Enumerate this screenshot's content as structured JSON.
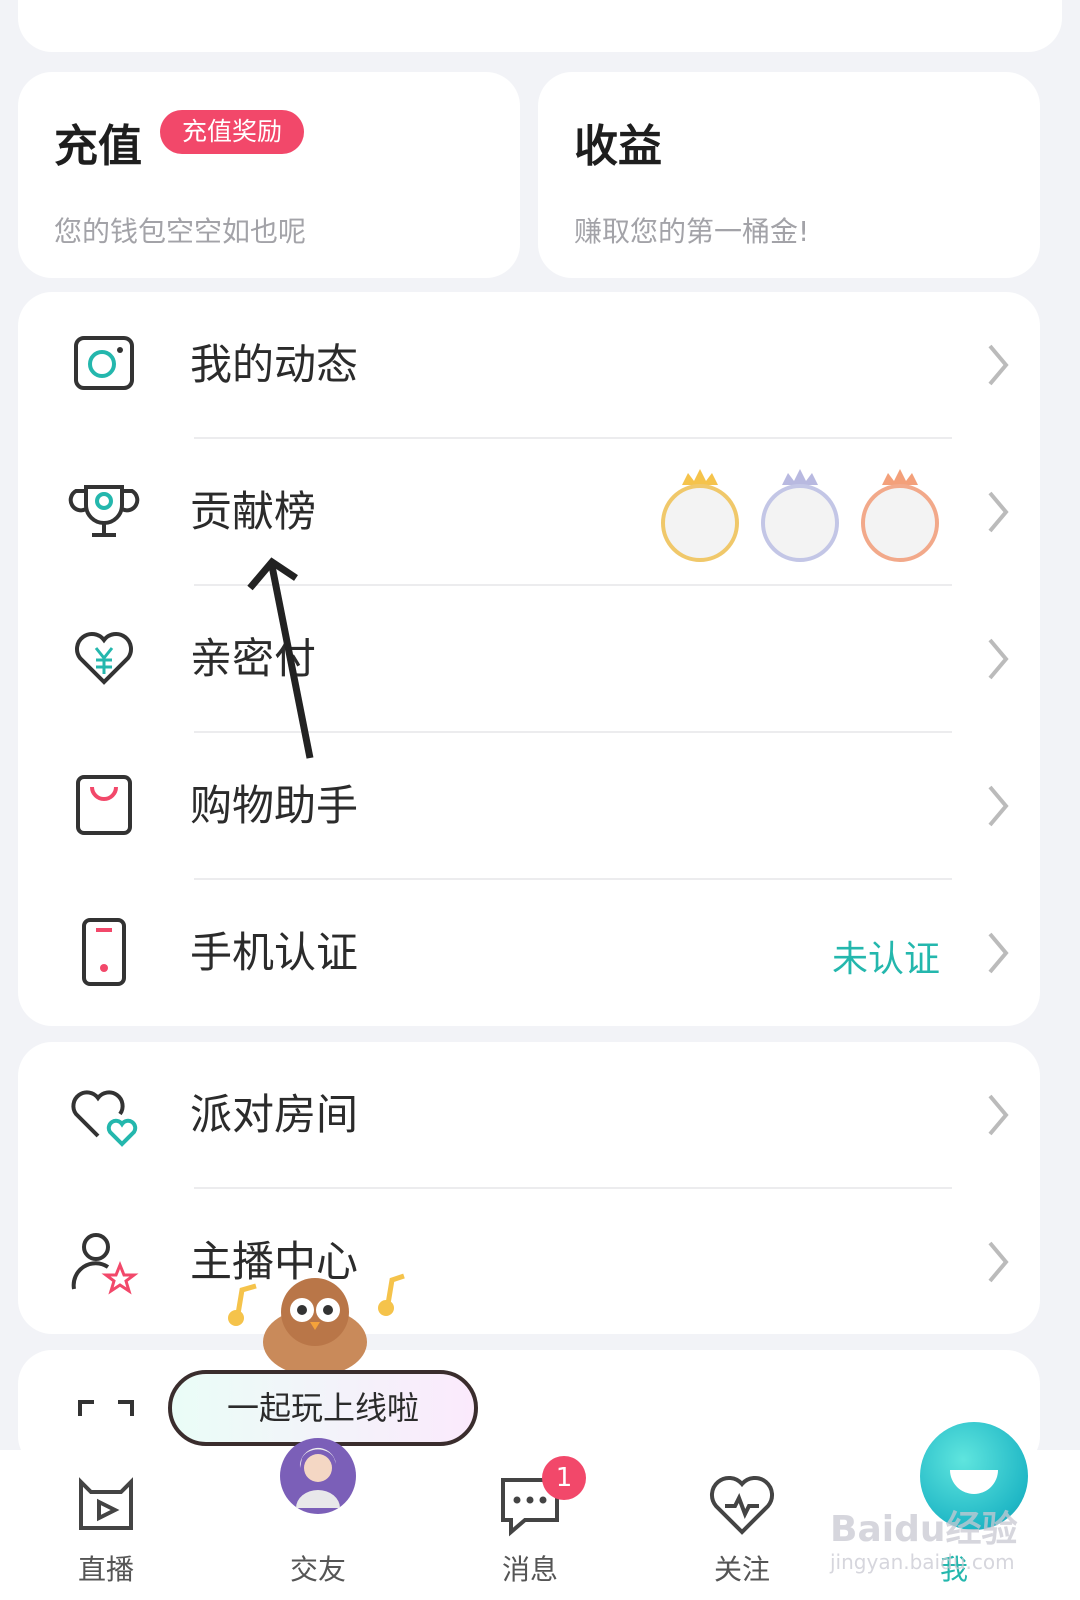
{
  "wallet": {
    "recharge": {
      "title": "充值",
      "badge": "充值奖励",
      "subtitle": "您的钱包空空如也呢"
    },
    "income": {
      "title": "收益",
      "subtitle": "赚取您的第一桶金!"
    }
  },
  "menu_group1": [
    {
      "label": "我的动态",
      "icon": "camera-icon"
    },
    {
      "label": "贡献榜",
      "icon": "trophy-icon"
    },
    {
      "label": "亲密付",
      "icon": "heart-yuan-icon"
    },
    {
      "label": "购物助手",
      "icon": "shopping-bag-icon"
    },
    {
      "label": "手机认证",
      "icon": "phone-icon",
      "status": "未认证"
    }
  ],
  "menu_group2": [
    {
      "label": "派对房间",
      "icon": "double-heart-icon"
    },
    {
      "label": "主播中心",
      "icon": "anchor-star-icon"
    }
  ],
  "popup": {
    "text": "一起玩上线啦"
  },
  "bottom_nav": [
    {
      "label": "直播",
      "icon": "live-tv-icon"
    },
    {
      "label": "交友",
      "icon": "avatar-icon"
    },
    {
      "label": "消息",
      "icon": "chat-icon",
      "badge": "1"
    },
    {
      "label": "关注",
      "icon": "heartbeat-icon"
    },
    {
      "label": "我",
      "icon": "me-icon",
      "active": true
    }
  ],
  "watermark": {
    "brand": "Baidu经验",
    "url": "jingyan.baidu.com"
  },
  "colors": {
    "accent_pink": "#f2486a",
    "accent_teal": "#24b7ad",
    "background": "#f2f3f7"
  }
}
